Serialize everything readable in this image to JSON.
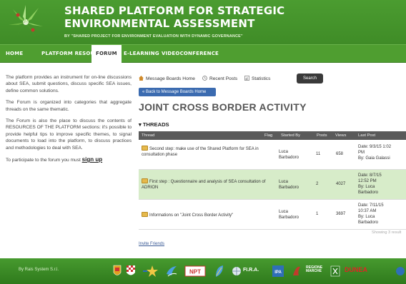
{
  "header": {
    "title_line1": "SHARED PLATFORM FOR STRATEGIC",
    "title_line2": "ENVIRONMENTAL ASSESSMENT",
    "subtitle": "BY \"SHARED PROJECT FOR ENVIRONMENT EVALUATION WITH DYNAMIC GOVERNANCE\""
  },
  "nav": {
    "items": [
      {
        "label": "HOME"
      },
      {
        "label": "PLATFORM RESOURCES"
      },
      {
        "label": "FORUM"
      },
      {
        "label": "E-LEARNING"
      },
      {
        "label": "VIDEOCONFERENCE"
      }
    ],
    "active": "FORUM"
  },
  "intro": {
    "p1": "The platform provides an instrument for on-line discussions about SEA, submit questions, discuss specific SEA issues, define common solutions.",
    "p2": "The Forum is organized into categories that aggregate threads on the same thematic.",
    "p3": "The Forum is also the place to discuss the contents of RESOURCES OF THE PLATFORM sections: it's possible to provide helpful tips to improve specific themes, to signal documents to load into the platform, to discuss practices and methodologies to deal with SEA.",
    "p4_prefix": "To participate to the forum you must ",
    "p4_link": "sign up"
  },
  "forum": {
    "links": {
      "home": "Message Boards Home",
      "recent": "Recent Posts",
      "stats": "Statistics"
    },
    "search_label": "Search",
    "back_label": "« Back to Message Boards Home",
    "title": "JOINT CROSS BORDER ACTIVITY",
    "threads_heading": "▾ THREADS",
    "columns": {
      "thread": "Thread",
      "flag": "Flag",
      "started_by": "Started By",
      "posts": "Posts",
      "views": "Views",
      "last_post": "Last Post"
    },
    "rows": [
      {
        "thread": "Second step: make use of the Shared Platform for SEA in consultation phase",
        "started_by_1": "Luca",
        "started_by_2": "Barbadoro",
        "posts": "11",
        "views": "658",
        "last_1": "Date: 9/3/15 1:02",
        "last_2": "PM",
        "last_3": "By: Gaia Galassi"
      },
      {
        "thread": "First step : Questionnaire and analysis of SEA consultation of ADRION",
        "started_by_1": "Luca",
        "started_by_2": "Barbadoro",
        "posts": "2",
        "views": "4027",
        "last_1": "Date: 8/7/15",
        "last_2": "12:52 PM",
        "last_3": "By: Luca",
        "last_4": "Barbadoro"
      },
      {
        "thread": "Informations on \"Joint Cross Border Activity\"",
        "started_by_1": "Luca",
        "started_by_2": "Barbadoro",
        "posts": "1",
        "views": "3697",
        "last_1": "Date: 7/11/15",
        "last_2": "10:37 AM",
        "last_3": "By: Luca",
        "last_4": "Barbadoro"
      }
    ],
    "showing": "Showing 3 result",
    "invite": "Invite Friends"
  },
  "footer": {
    "credit": "By Rais System S.r.l.",
    "logo_texts": {
      "ipa": "IPA",
      "fira": "FI.R.A.",
      "regione": "REGIONE MARCHE",
      "dunea": "DUNEA"
    }
  },
  "colors": {
    "header_green": "#4a9a2e",
    "nav_green": "#4f9e30",
    "back_button_blue": "#3b6bb0",
    "table_header_grey": "#5a5a5a",
    "highlight_row_green": "#d7ecc9"
  }
}
